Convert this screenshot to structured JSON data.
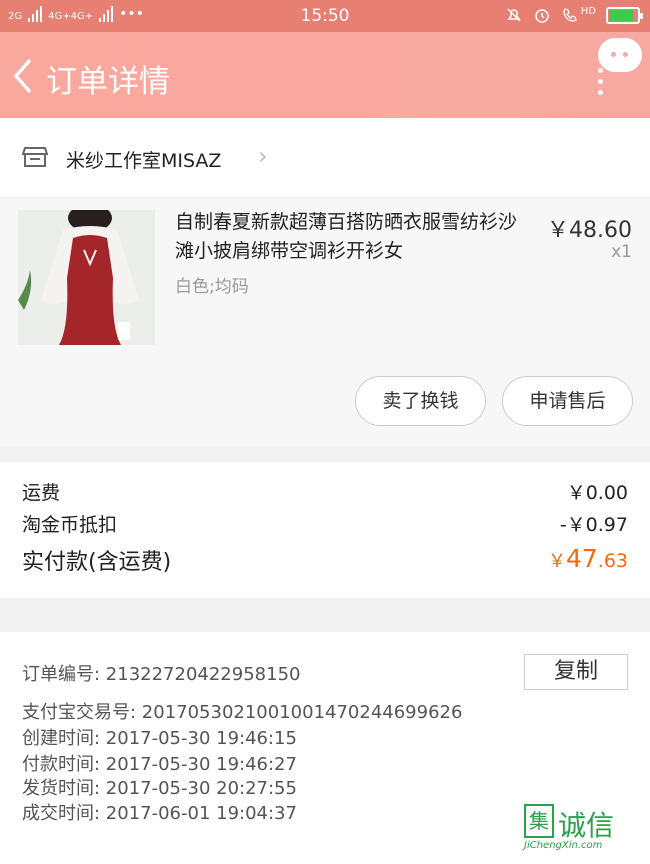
{
  "status_bar": {
    "signal1": "2G",
    "signal2": "4G+4G+",
    "dots": "•••",
    "time": "15:50",
    "hd": "HD",
    "battery_level": 0.8
  },
  "nav": {
    "back_icon": "‹",
    "title": "订单详情"
  },
  "shop": {
    "name": "米纱工作室MISAZ",
    "arrow": "›"
  },
  "item": {
    "title": "自制春夏新款超薄百搭防晒衣服雪纺衫沙滩小披肩绑带空调衫开衫女",
    "spec": "白色;均码",
    "price": "￥48.60",
    "qty": "x1",
    "buttons": {
      "sell": "卖了换钱",
      "after_sale": "申请售后"
    }
  },
  "fees": {
    "shipping_label": "运费",
    "shipping_value": "￥0.00",
    "coin_label": "淘金币抵扣",
    "coin_value": "-￥0.97",
    "paid_label": "实付款(含运费)",
    "paid_symbol": "￥",
    "paid_int": "47",
    "paid_dec": ".63"
  },
  "order_info": {
    "order_no": "订单编号:    21322720422958150",
    "copy_label": "复制",
    "alipay_no": "支付宝交易号:    2017053021001001470244699626",
    "created": "创建时间:    2017-05-30  19:46:15",
    "paid": "付款时间:    2017-05-30  19:46:27",
    "shipped": "发货时间:    2017-05-30  20:27:55",
    "completed": "成交时间:    2017-06-01  19:04:37"
  },
  "watermark": {
    "box_char": "集",
    "text": "诚信",
    "url": "JiChengXin.com"
  },
  "colors": {
    "nav_bg": "#f7a9a1",
    "status_bg": "#e77f72",
    "price_accent": "#f26a12"
  }
}
